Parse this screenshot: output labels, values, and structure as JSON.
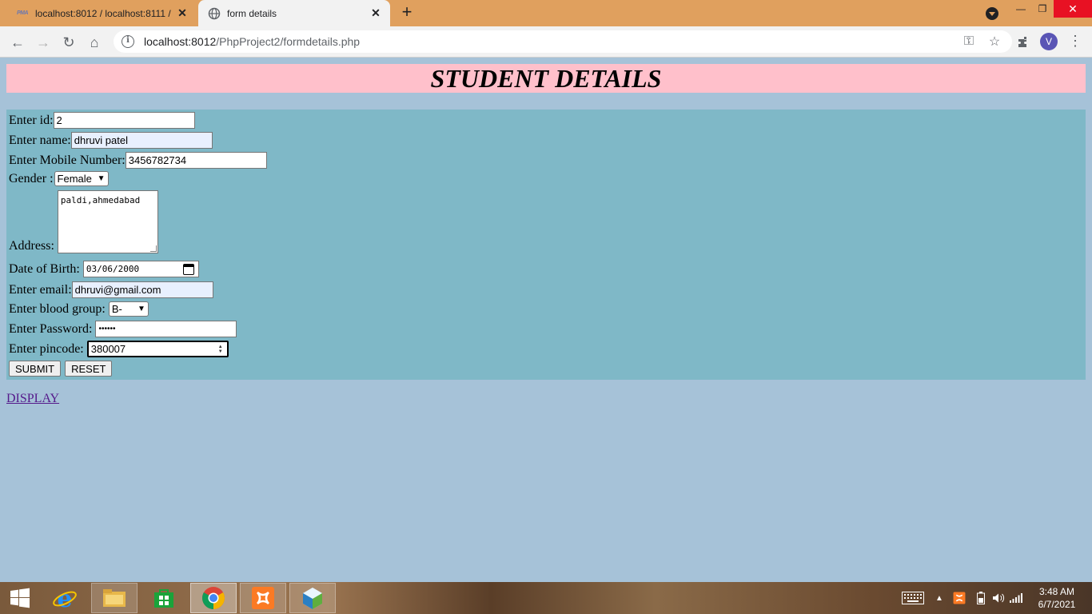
{
  "browser": {
    "tabs": [
      {
        "title": "localhost:8012 / localhost:8111 /",
        "favicon": "PMA"
      },
      {
        "title": "form details"
      }
    ],
    "url_host": "localhost:8012",
    "url_path": "/PhpProject2/formdetails.php",
    "profile_initial": "V"
  },
  "page": {
    "heading": "STUDENT DETAILS",
    "form": {
      "id_label": "Enter id:",
      "id_value": "2",
      "name_label": "Enter name:",
      "name_value": "dhruvi patel",
      "mobile_label": "Enter Mobile Number:",
      "mobile_value": "3456782734",
      "gender_label": "Gender :",
      "gender_value": "Female",
      "address_label": "Address:",
      "address_value": "paldi,ahmedabad",
      "dob_label": "Date of Birth:",
      "dob_value": "03/06/2000",
      "email_label": "Enter email:",
      "email_value": "dhruvi@gmail.com",
      "blood_label": "Enter blood group:",
      "blood_value": "B-",
      "password_label": "Enter Password:",
      "password_value": "••••••",
      "pincode_label": "Enter pincode:",
      "pincode_value": "380007",
      "submit_label": "SUBMIT",
      "reset_label": "RESET"
    },
    "display_link": "DISPLAY"
  },
  "taskbar": {
    "time": "3:48 AM",
    "date": "6/7/2021"
  },
  "colors": {
    "tabstrip": "#e0a05e",
    "page_bg": "#a6c2d8",
    "header_bg": "#ffc0cb",
    "form_bg": "#7fb8c7",
    "link": "#551a8b"
  }
}
